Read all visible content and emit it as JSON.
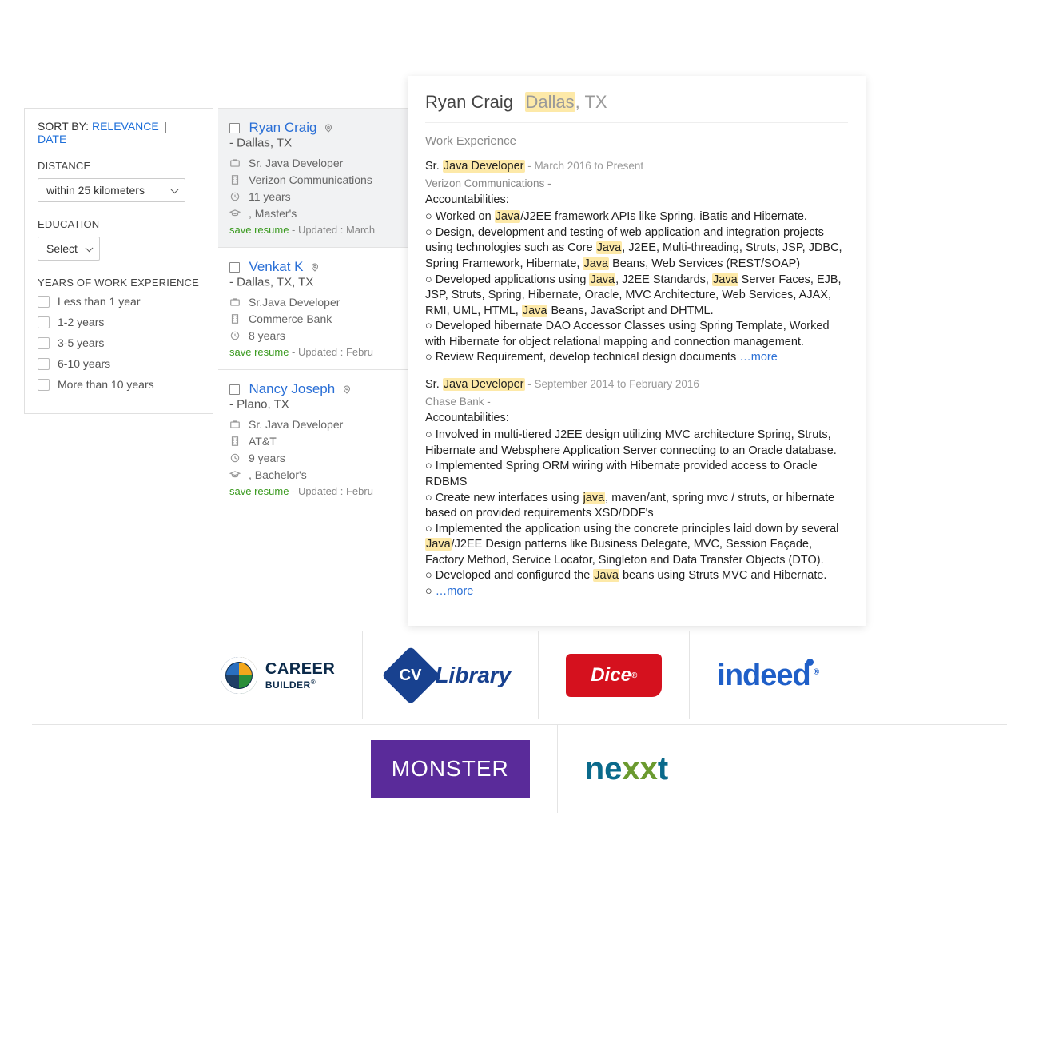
{
  "sort": {
    "label": "SORT BY:",
    "relevance": "RELEVANCE",
    "separator": "|",
    "date": "DATE"
  },
  "filters": {
    "distance_label": "DISTANCE",
    "distance_value": "within 25 kilometers",
    "education_label": "EDUCATION",
    "education_value": "Select",
    "experience_label": "YEARS OF WORK EXPERIENCE",
    "experience_options": [
      "Less than 1 year",
      "1-2 years",
      "3-5 years",
      "6-10 years",
      "More than 10 years"
    ]
  },
  "results": [
    {
      "name": "Ryan Craig",
      "location": "- Dallas, TX",
      "title": "Sr. Java Developer",
      "company": "Verizon Communications",
      "years": "11 years",
      "degree": ", Master's",
      "save": "save resume",
      "updated": " - Updated : March"
    },
    {
      "name": "Venkat K",
      "location": "- Dallas, TX, TX",
      "title": "Sr.Java Developer",
      "company": "Commerce Bank",
      "years": "8 years",
      "degree": "",
      "save": "save resume",
      "updated": " - Updated : Febru"
    },
    {
      "name": "Nancy Joseph",
      "location": "- Plano, TX",
      "title": "Sr. Java Developer",
      "company": "AT&T",
      "years": "9 years",
      "degree": ", Bachelor's",
      "save": "save resume",
      "updated": " - Updated : Febru"
    }
  ],
  "detail": {
    "name": "Ryan Craig",
    "loc_hl": "Dallas",
    "loc_rest": ", TX",
    "section": "Work Experience",
    "jobs": [
      {
        "title_prefix": "Sr. ",
        "title_hl": "Java Developer",
        "dates": " - March 2016 to Present",
        "company": "Verizon Communications -",
        "acc_label": "Accountabilities:",
        "bullets": [
          {
            "pre": "○ Worked on ",
            "hl": "Java",
            "post": "/J2EE framework APIs like Spring, iBatis and Hibernate."
          },
          {
            "pre": "○ Design, development and testing of web application and integration projects using technologies such as Core ",
            "hl": "Java",
            "post": ", J2EE, Multi-threading, Struts, JSP, JDBC, Spring Framework, Hibernate, ",
            "hl2": "Java",
            "post2": " Beans, Web Services (REST/SOAP)"
          },
          {
            "pre": "○ Developed applications using ",
            "hl": "Java",
            "post": ", J2EE Standards, ",
            "hl2": "Java",
            "post2": " Server Faces, EJB, JSP, Struts, Spring, Hibernate, Oracle, MVC Architecture, Web Services, AJAX, RMI, UML, HTML, ",
            "hl3": "Java",
            "post3": " Beans, JavaScript and DHTML."
          },
          {
            "pre": "○ Developed hibernate DAO Accessor Classes using Spring Template, Worked with Hibernate for object relational mapping and connection management.",
            "hl": "",
            "post": ""
          },
          {
            "pre": "○ Review Requirement, develop technical design documents ",
            "hl": "",
            "post": "",
            "more": "…more"
          }
        ]
      },
      {
        "title_prefix": "Sr. ",
        "title_hl": "Java Developer",
        "dates": " - September 2014 to February 2016",
        "company": "Chase Bank -",
        "acc_label": "Accountabilities:",
        "bullets": [
          {
            "pre": "○ Involved in multi-tiered J2EE design utilizing MVC architecture Spring, Struts, Hibernate and Websphere Application Server connecting to an Oracle database.",
            "hl": "",
            "post": ""
          },
          {
            "pre": "○ Implemented Spring ORM wiring with Hibernate provided access to Oracle RDBMS",
            "hl": "",
            "post": ""
          },
          {
            "pre": "○ Create new interfaces using ",
            "hl": "java",
            "post": ", maven/ant, spring mvc / struts, or hibernate based on provided requirements XSD/DDF's"
          },
          {
            "pre": "○ Implemented the application using the concrete principles laid down by several ",
            "hl": "Java",
            "post": "/J2EE Design patterns like Business Delegate, MVC, Session Façade, Factory Method, Service Locator, Singleton and Data Transfer Objects (DTO)."
          },
          {
            "pre": "○ Developed and configured the ",
            "hl": "Java",
            "post": " beans using Struts MVC and Hibernate."
          },
          {
            "pre": "○ ",
            "hl": "",
            "post": "",
            "more": "…more"
          }
        ]
      }
    ]
  },
  "logos_row1": [
    "CareerBuilder",
    "CV-Library",
    "Dice",
    "indeed"
  ],
  "logos_row2": [
    "Monster",
    "nexxt"
  ]
}
